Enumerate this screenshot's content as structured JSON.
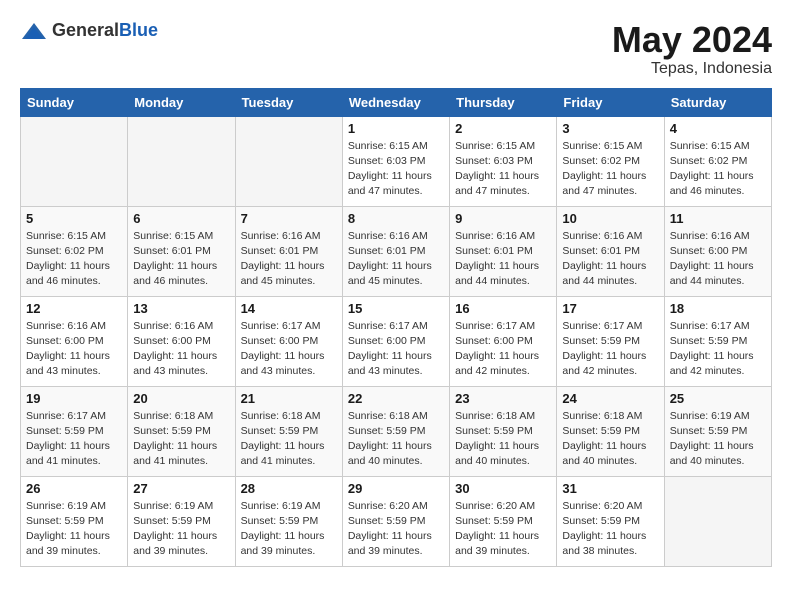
{
  "header": {
    "logo_general": "General",
    "logo_blue": "Blue",
    "month_year": "May 2024",
    "location": "Tepas, Indonesia"
  },
  "weekdays": [
    "Sunday",
    "Monday",
    "Tuesday",
    "Wednesday",
    "Thursday",
    "Friday",
    "Saturday"
  ],
  "weeks": [
    [
      {
        "day": "",
        "info": ""
      },
      {
        "day": "",
        "info": ""
      },
      {
        "day": "",
        "info": ""
      },
      {
        "day": "1",
        "info": "Sunrise: 6:15 AM\nSunset: 6:03 PM\nDaylight: 11 hours\nand 47 minutes."
      },
      {
        "day": "2",
        "info": "Sunrise: 6:15 AM\nSunset: 6:03 PM\nDaylight: 11 hours\nand 47 minutes."
      },
      {
        "day": "3",
        "info": "Sunrise: 6:15 AM\nSunset: 6:02 PM\nDaylight: 11 hours\nand 47 minutes."
      },
      {
        "day": "4",
        "info": "Sunrise: 6:15 AM\nSunset: 6:02 PM\nDaylight: 11 hours\nand 46 minutes."
      }
    ],
    [
      {
        "day": "5",
        "info": "Sunrise: 6:15 AM\nSunset: 6:02 PM\nDaylight: 11 hours\nand 46 minutes."
      },
      {
        "day": "6",
        "info": "Sunrise: 6:15 AM\nSunset: 6:01 PM\nDaylight: 11 hours\nand 46 minutes."
      },
      {
        "day": "7",
        "info": "Sunrise: 6:16 AM\nSunset: 6:01 PM\nDaylight: 11 hours\nand 45 minutes."
      },
      {
        "day": "8",
        "info": "Sunrise: 6:16 AM\nSunset: 6:01 PM\nDaylight: 11 hours\nand 45 minutes."
      },
      {
        "day": "9",
        "info": "Sunrise: 6:16 AM\nSunset: 6:01 PM\nDaylight: 11 hours\nand 44 minutes."
      },
      {
        "day": "10",
        "info": "Sunrise: 6:16 AM\nSunset: 6:01 PM\nDaylight: 11 hours\nand 44 minutes."
      },
      {
        "day": "11",
        "info": "Sunrise: 6:16 AM\nSunset: 6:00 PM\nDaylight: 11 hours\nand 44 minutes."
      }
    ],
    [
      {
        "day": "12",
        "info": "Sunrise: 6:16 AM\nSunset: 6:00 PM\nDaylight: 11 hours\nand 43 minutes."
      },
      {
        "day": "13",
        "info": "Sunrise: 6:16 AM\nSunset: 6:00 PM\nDaylight: 11 hours\nand 43 minutes."
      },
      {
        "day": "14",
        "info": "Sunrise: 6:17 AM\nSunset: 6:00 PM\nDaylight: 11 hours\nand 43 minutes."
      },
      {
        "day": "15",
        "info": "Sunrise: 6:17 AM\nSunset: 6:00 PM\nDaylight: 11 hours\nand 43 minutes."
      },
      {
        "day": "16",
        "info": "Sunrise: 6:17 AM\nSunset: 6:00 PM\nDaylight: 11 hours\nand 42 minutes."
      },
      {
        "day": "17",
        "info": "Sunrise: 6:17 AM\nSunset: 5:59 PM\nDaylight: 11 hours\nand 42 minutes."
      },
      {
        "day": "18",
        "info": "Sunrise: 6:17 AM\nSunset: 5:59 PM\nDaylight: 11 hours\nand 42 minutes."
      }
    ],
    [
      {
        "day": "19",
        "info": "Sunrise: 6:17 AM\nSunset: 5:59 PM\nDaylight: 11 hours\nand 41 minutes."
      },
      {
        "day": "20",
        "info": "Sunrise: 6:18 AM\nSunset: 5:59 PM\nDaylight: 11 hours\nand 41 minutes."
      },
      {
        "day": "21",
        "info": "Sunrise: 6:18 AM\nSunset: 5:59 PM\nDaylight: 11 hours\nand 41 minutes."
      },
      {
        "day": "22",
        "info": "Sunrise: 6:18 AM\nSunset: 5:59 PM\nDaylight: 11 hours\nand 40 minutes."
      },
      {
        "day": "23",
        "info": "Sunrise: 6:18 AM\nSunset: 5:59 PM\nDaylight: 11 hours\nand 40 minutes."
      },
      {
        "day": "24",
        "info": "Sunrise: 6:18 AM\nSunset: 5:59 PM\nDaylight: 11 hours\nand 40 minutes."
      },
      {
        "day": "25",
        "info": "Sunrise: 6:19 AM\nSunset: 5:59 PM\nDaylight: 11 hours\nand 40 minutes."
      }
    ],
    [
      {
        "day": "26",
        "info": "Sunrise: 6:19 AM\nSunset: 5:59 PM\nDaylight: 11 hours\nand 39 minutes."
      },
      {
        "day": "27",
        "info": "Sunrise: 6:19 AM\nSunset: 5:59 PM\nDaylight: 11 hours\nand 39 minutes."
      },
      {
        "day": "28",
        "info": "Sunrise: 6:19 AM\nSunset: 5:59 PM\nDaylight: 11 hours\nand 39 minutes."
      },
      {
        "day": "29",
        "info": "Sunrise: 6:20 AM\nSunset: 5:59 PM\nDaylight: 11 hours\nand 39 minutes."
      },
      {
        "day": "30",
        "info": "Sunrise: 6:20 AM\nSunset: 5:59 PM\nDaylight: 11 hours\nand 39 minutes."
      },
      {
        "day": "31",
        "info": "Sunrise: 6:20 AM\nSunset: 5:59 PM\nDaylight: 11 hours\nand 38 minutes."
      },
      {
        "day": "",
        "info": ""
      }
    ]
  ]
}
